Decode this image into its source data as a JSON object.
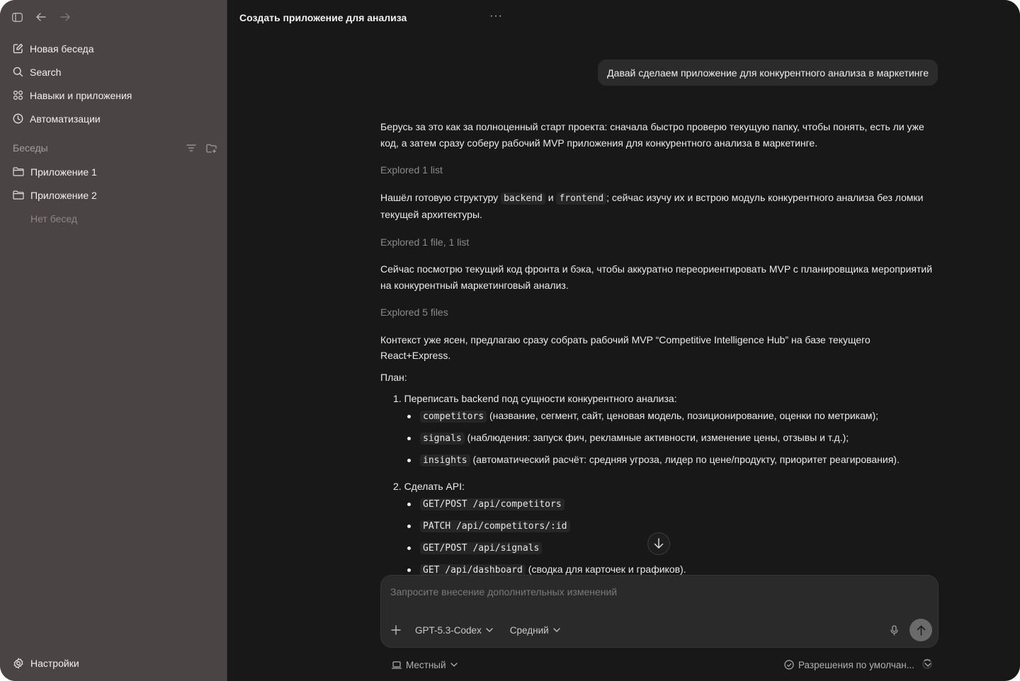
{
  "sidebar": {
    "nav": [
      {
        "label": "Новая беседа",
        "icon": "edit-icon"
      },
      {
        "label": "Search",
        "icon": "search-icon"
      },
      {
        "label": "Навыки и приложения",
        "icon": "grid-icon"
      },
      {
        "label": "Автоматизации",
        "icon": "clock-icon"
      }
    ],
    "section_title": "Беседы",
    "projects": [
      {
        "label": "Приложение 1",
        "icon": "folder-icon"
      },
      {
        "label": "Приложение 2",
        "icon": "folder-icon"
      }
    ],
    "empty_text": "Нет бесед",
    "settings_label": "Настройки"
  },
  "main": {
    "title": "Создать приложение для анализа",
    "more": "···",
    "user_message": "Давай сделаем приложение для конкурентного анализа в маркетинге",
    "assistant": {
      "p1": "Берусь за это как за полноценный старт проекта: сначала быстро проверю текущую папку, чтобы понять, есть ли уже код, а затем сразу соберу рабочий MVP приложения для конкурентного анализа в маркетинге.",
      "explored1": "Explored 1 list",
      "p2_a": "Нашёл готовую структуру ",
      "p2_code1": "backend",
      "p2_b": " и ",
      "p2_code2": "frontend",
      "p2_c": "; сейчас изучу их и встрою модуль конкурентного анализа без ломки текущей архитектуры.",
      "explored2": "Explored 1 file, 1 list",
      "p3": "Сейчас посмотрю текущий код фронта и бэка, чтобы аккуратно переориентировать MVP с планировщика мероприятий на конкурентный маркетинговый анализ.",
      "explored3": "Explored 5 files",
      "p4": "Контекст уже ясен, предлагаю сразу собрать рабочий MVP “Competitive Intelligence Hub” на базе текущего React+Express.",
      "plan_label": "План:",
      "step1": "1. Переписать backend под сущности конкурентного анализа:",
      "step1_items": [
        {
          "code": "competitors",
          "text": " (название, сегмент, сайт, ценовая модель, позиционирование, оценки по метрикам);"
        },
        {
          "code": "signals",
          "text": " (наблюдения: запуск фич, рекламные активности, изменение цены, отзывы и т.д.);"
        },
        {
          "code": "insights",
          "text": " (автоматический расчёт: средняя угроза, лидер по цене/продукту, приоритет реагирования)."
        }
      ],
      "step2": "2. Сделать API:",
      "step2_items": [
        {
          "code": "GET/POST /api/competitors",
          "text": ""
        },
        {
          "code": "PATCH /api/competitors/:id",
          "text": ""
        },
        {
          "code": "GET/POST /api/signals",
          "text": ""
        },
        {
          "code": "GET /api/dashboard",
          "text": " (сводка для карточек и графиков)."
        }
      ]
    },
    "composer": {
      "placeholder": "Запросите внесение дополнительных изменений",
      "model": "GPT-5.3-Codex",
      "effort": "Средний"
    },
    "footer": {
      "environment": "Местный",
      "permissions": "Разрешения по умолчан..."
    }
  }
}
